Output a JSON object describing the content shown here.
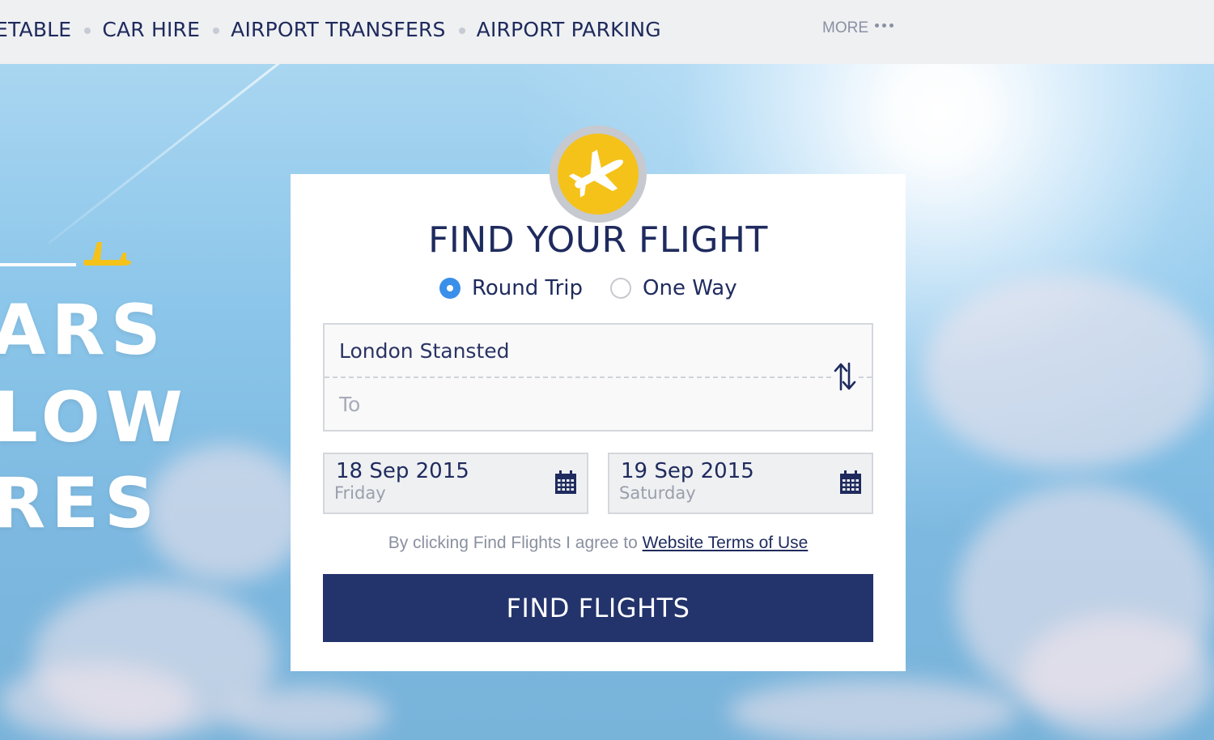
{
  "nav": {
    "items": [
      {
        "label": "ETABLE"
      },
      {
        "label": "CAR HIRE"
      },
      {
        "label": "AIRPORT TRANSFERS"
      },
      {
        "label": "AIRPORT PARKING"
      }
    ],
    "more_label": "MORE"
  },
  "hero": {
    "lines": [
      "ARS",
      "LOW",
      "RES"
    ]
  },
  "search": {
    "title": "FIND YOUR FLIGHT",
    "trip_types": [
      {
        "label": "Round Trip",
        "selected": true
      },
      {
        "label": "One Way",
        "selected": false
      }
    ],
    "from_value": "London Stansted",
    "to_placeholder": "To",
    "depart": {
      "date": "18 Sep 2015",
      "weekday": "Friday"
    },
    "return": {
      "date": "19 Sep 2015",
      "weekday": "Saturday"
    },
    "terms_prefix": "By clicking Find Flights I agree to",
    "terms_link": "Website Terms of Use",
    "submit_label": "FIND FLIGHTS"
  },
  "colors": {
    "brand_navy": "#23336b",
    "brand_yellow": "#f5c21a",
    "radio_selected": "#3a8fe8"
  }
}
